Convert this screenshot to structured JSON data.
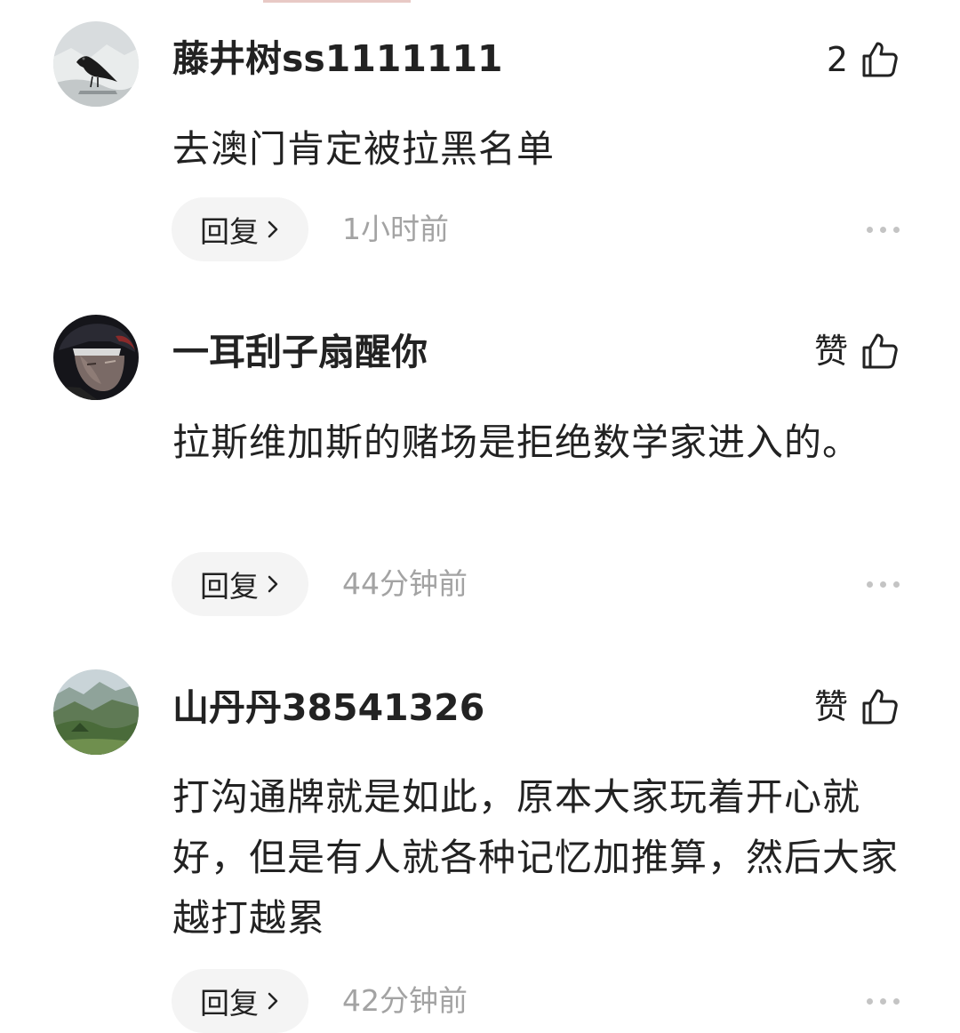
{
  "comments": [
    {
      "username": "藤井树ss1111111",
      "like_label": "2",
      "text": "去澳门肯定被拉黑名单",
      "reply_label": "回复",
      "time": "1小时前",
      "avatar": "crow-avatar"
    },
    {
      "username": "一耳刮子扇醒你",
      "like_label": "赞",
      "text": "拉斯维加斯的赌场是拒绝数学家进入的。",
      "reply_label": "回复",
      "time": "44分钟前",
      "avatar": "anime-character-avatar"
    },
    {
      "username": "山丹丹38541326",
      "like_label": "赞",
      "text": "打沟通牌就是如此，原本大家玩着开心就好，但是有人就各种记忆加推算，然后大家越打越累",
      "reply_label": "回复",
      "time": "42分钟前",
      "avatar": "mountain-landscape-avatar"
    }
  ],
  "icons": {
    "like": "thumbs-up-icon",
    "reply_arrow": "chevron-right-icon",
    "more": "more-dots-icon"
  },
  "colors": {
    "text": "#222222",
    "muted": "#a3a3a3",
    "reply_bg": "#f4f4f4"
  }
}
